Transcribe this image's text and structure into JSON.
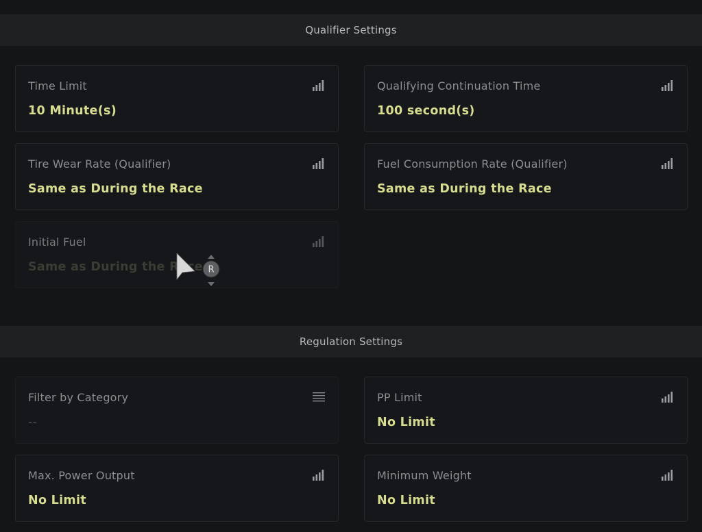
{
  "qualifier": {
    "header": "Qualifier Settings",
    "cards": [
      {
        "label": "Time Limit",
        "value": "10 Minute(s)",
        "icon": "signal-bars-icon"
      },
      {
        "label": "Qualifying Continuation Time",
        "value": "100 second(s)",
        "icon": "signal-bars-icon"
      },
      {
        "label": "Tire Wear Rate (Qualifier)",
        "value": "Same as During the Race",
        "icon": "signal-bars-icon"
      },
      {
        "label": "Fuel Consumption Rate (Qualifier)",
        "value": "Same as During the Race",
        "icon": "signal-bars-icon"
      },
      {
        "label": "Initial Fuel",
        "value": "Same as During the Race",
        "icon": "signal-bars-icon",
        "state": "disabled"
      }
    ]
  },
  "regulation": {
    "header": "Regulation Settings",
    "cards": [
      {
        "label": "Filter by Category",
        "value": "--",
        "icon": "list-icon"
      },
      {
        "label": "PP Limit",
        "value": "No Limit",
        "icon": "signal-bars-icon"
      },
      {
        "label": "Max. Power Output",
        "value": "No Limit",
        "icon": "signal-bars-icon"
      },
      {
        "label": "Minimum Weight",
        "value": "No Limit",
        "icon": "signal-bars-icon"
      }
    ]
  },
  "cursor": {
    "badge": "R",
    "icon": "pointer-cursor-icon"
  },
  "colors": {
    "background": "#141517",
    "header_bar": "#1f2022",
    "value_accent": "#d7dc90",
    "label": "#8c8e91"
  }
}
